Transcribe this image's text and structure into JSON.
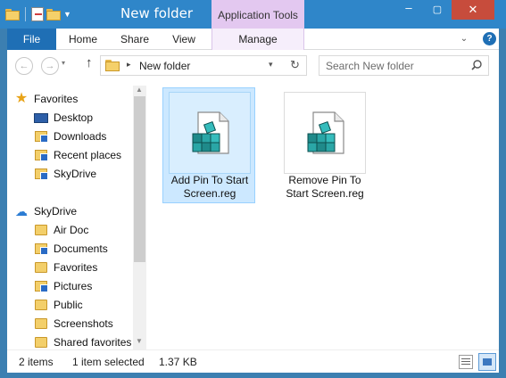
{
  "window": {
    "title": "New folder",
    "context_tab_group": "Application Tools",
    "controls": {
      "minimize": "–",
      "maximize": "▢",
      "close": "✕"
    }
  },
  "ribbon": {
    "tabs": [
      "File",
      "Home",
      "Share",
      "View",
      "Manage"
    ],
    "expand_glyph": "⌄",
    "help_glyph": "?"
  },
  "navigation": {
    "back_glyph": "←",
    "forward_glyph": "→",
    "recent_glyph": "▾",
    "up_glyph": "↑",
    "address": {
      "separator": "▸",
      "path": "New folder",
      "dropdown": "▾",
      "refresh": "↻"
    },
    "search": {
      "placeholder": "Search New folder"
    }
  },
  "nav_pane": {
    "favorites_header": "Favorites",
    "favorites": [
      "Desktop",
      "Downloads",
      "Recent places",
      "SkyDrive"
    ],
    "skydrive_header": "SkyDrive",
    "skydrive_items": [
      "Air Doc",
      "Documents",
      "Favorites",
      "Pictures",
      "Public",
      "Screenshots",
      "Shared favorites"
    ],
    "scroll": {
      "up": "▲",
      "down": "▼"
    }
  },
  "files": [
    {
      "name": "Add Pin To Start Screen.reg",
      "selected": true,
      "icon": "registry-file-icon"
    },
    {
      "name": "Remove Pin To Start Screen.reg",
      "selected": false,
      "icon": "registry-file-icon"
    }
  ],
  "status": {
    "item_count": "2 items",
    "selection": "1 item selected",
    "size": "1.37 KB"
  },
  "colors": {
    "titlebar": "#2f86c9",
    "file_tab": "#1f6fb5",
    "context_tab": "#e3c8f0",
    "selection": "#cce8ff"
  }
}
